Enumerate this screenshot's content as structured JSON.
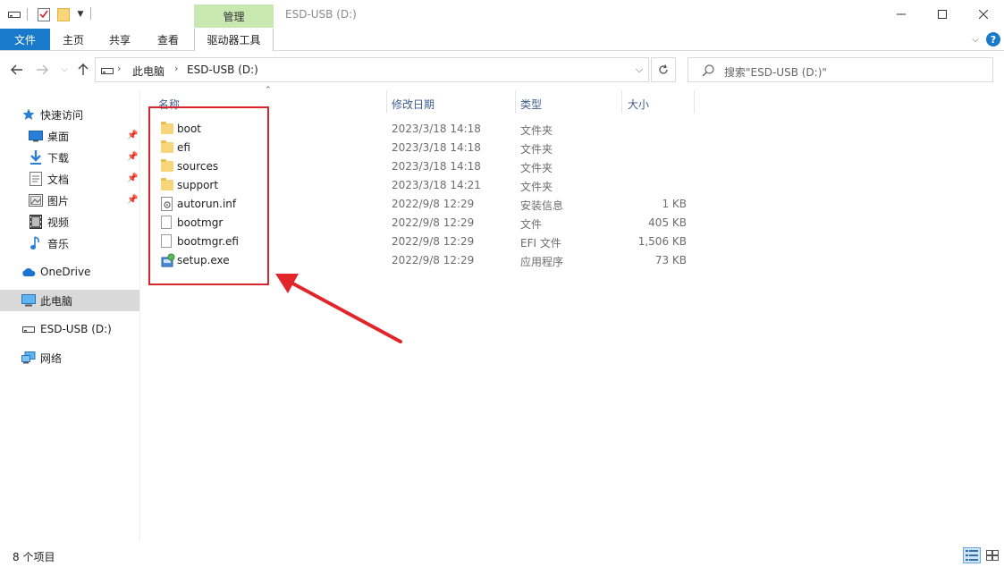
{
  "window": {
    "title": "ESD-USB (D:)",
    "context_tab": "管理"
  },
  "ribbon": {
    "tabs": [
      "文件",
      "主页",
      "共享",
      "查看",
      "驱动器工具"
    ]
  },
  "address": {
    "segments": [
      "此电脑",
      "ESD-USB (D:)"
    ]
  },
  "search": {
    "placeholder": "搜索\"ESD-USB (D:)\""
  },
  "sidebar": {
    "items": [
      {
        "label": "快速访问",
        "icon": "star-icon"
      },
      {
        "label": "桌面",
        "icon": "desktop-icon"
      },
      {
        "label": "下载",
        "icon": "download-icon"
      },
      {
        "label": "文档",
        "icon": "document-icon"
      },
      {
        "label": "图片",
        "icon": "picture-icon"
      },
      {
        "label": "视频",
        "icon": "video-icon"
      },
      {
        "label": "音乐",
        "icon": "music-icon"
      },
      {
        "label": "OneDrive",
        "icon": "cloud-icon"
      },
      {
        "label": "此电脑",
        "icon": "computer-icon"
      },
      {
        "label": "ESD-USB (D:)",
        "icon": "usb-drive-icon"
      },
      {
        "label": "网络",
        "icon": "network-icon"
      }
    ]
  },
  "columns": [
    "名称",
    "修改日期",
    "类型",
    "大小"
  ],
  "files": [
    {
      "name": "boot",
      "date": "2023/3/18 14:18",
      "type": "文件夹",
      "size": "",
      "icon": "folder-icon"
    },
    {
      "name": "efi",
      "date": "2023/3/18 14:18",
      "type": "文件夹",
      "size": "",
      "icon": "folder-icon"
    },
    {
      "name": "sources",
      "date": "2023/3/18 14:18",
      "type": "文件夹",
      "size": "",
      "icon": "folder-icon"
    },
    {
      "name": "support",
      "date": "2023/3/18 14:21",
      "type": "文件夹",
      "size": "",
      "icon": "folder-icon"
    },
    {
      "name": "autorun.inf",
      "date": "2022/9/8 12:29",
      "type": "安装信息",
      "size": "1 KB",
      "icon": "settings-file-icon"
    },
    {
      "name": "bootmgr",
      "date": "2022/9/8 12:29",
      "type": "文件",
      "size": "405 KB",
      "icon": "file-icon"
    },
    {
      "name": "bootmgr.efi",
      "date": "2022/9/8 12:29",
      "type": "EFI 文件",
      "size": "1,506 KB",
      "icon": "file-icon"
    },
    {
      "name": "setup.exe",
      "date": "2022/9/8 12:29",
      "type": "应用程序",
      "size": "73 KB",
      "icon": "setup-exe-icon"
    }
  ],
  "status": {
    "count": "8 个项目"
  },
  "colors": {
    "accent": "#1979ca",
    "manage_tab": "#c8e8b2",
    "highlight": "#d8252b"
  }
}
